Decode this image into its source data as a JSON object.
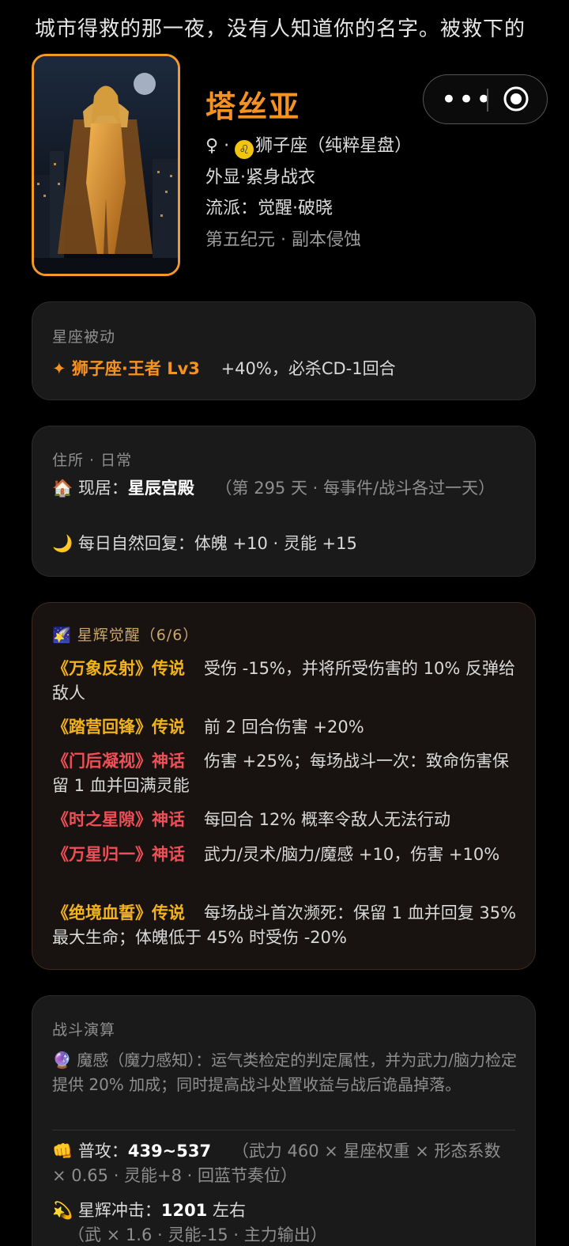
{
  "intro_text": "城市得救的那一夜，没有人知道你的名字。被救下的",
  "character": {
    "name": "塔丝亚",
    "gender_symbol": "♀",
    "zodiac_glyph": "♌",
    "zodiac_text": "狮子座（纯粹星盘）",
    "appearance": "外显·紧身战衣",
    "school": "流派：觉醒·破晓",
    "era": "第五纪元 · 副本侵蚀"
  },
  "menu": {
    "more_label": "•••"
  },
  "constellation": {
    "label": "星座被动",
    "skill_name": "✦ 狮子座·王者 Lv3",
    "skill_effect": "+40%，必杀CD-1回合"
  },
  "residence": {
    "label": "住所 · 日常",
    "home_icon": "🏠",
    "home_prefix": "现居：",
    "home_name": "星辰宫殿",
    "home_note": "（第 295 天 · 每事件/战斗各过一天）",
    "moon_icon": "🌙",
    "recovery": "每日自然回复：体魄 +10 · 灵能 +15"
  },
  "awakening": {
    "icon": "🌠",
    "label": "星辉觉醒（6/6）",
    "items": [
      {
        "name": "《万象反射》传说",
        "desc": "受伤 -15%，并将所受伤害的 10% 反弹给敌人"
      },
      {
        "name": "《踏营回锋》传说",
        "desc": "前 2 回合伤害 +20%"
      },
      {
        "name": "《门后凝视》神话",
        "desc": "伤害 +25%；每场战斗一次：致命伤害保留 1 血并回满灵能"
      },
      {
        "name": "《时之星隙》神话",
        "desc": "每回合 12% 概率令敌人无法行动"
      },
      {
        "name": "《万星归一》神话",
        "desc": "武力/灵术/脑力/魔感 +10，伤害 +10%"
      },
      {
        "name": "《绝境血誓》传说",
        "desc": "每场战斗首次濒死：保留 1 血并回复 35% 最大生命；体魄低于 45% 时受伤 -20%"
      }
    ]
  },
  "battle": {
    "label": "战斗演算",
    "magic_icon": "🔮",
    "magic_desc": "魔感（魔力感知）：运气类检定的判定属性，并为武力/脑力检定提供 20% 加成；同时提高战斗处置收益与战后诡晶掉落。",
    "attack_icon": "👊",
    "attack_label": "普攻：",
    "attack_value": "439~537",
    "attack_note": "（武力 460 × 星座权重 × 形态系数 × 0.65 · 灵能+8 · 回蓝节奏位）",
    "burst_icon": "💫",
    "burst_label": "星辉冲击：",
    "burst_value": "1201",
    "burst_suffix": " 左右",
    "burst_note": "（武 × 1.6 · 灵能-15 · 主力输出）"
  },
  "colors": {
    "accent": "#f59222",
    "legend": "#f2b21b",
    "myth": "#ef4f56"
  }
}
